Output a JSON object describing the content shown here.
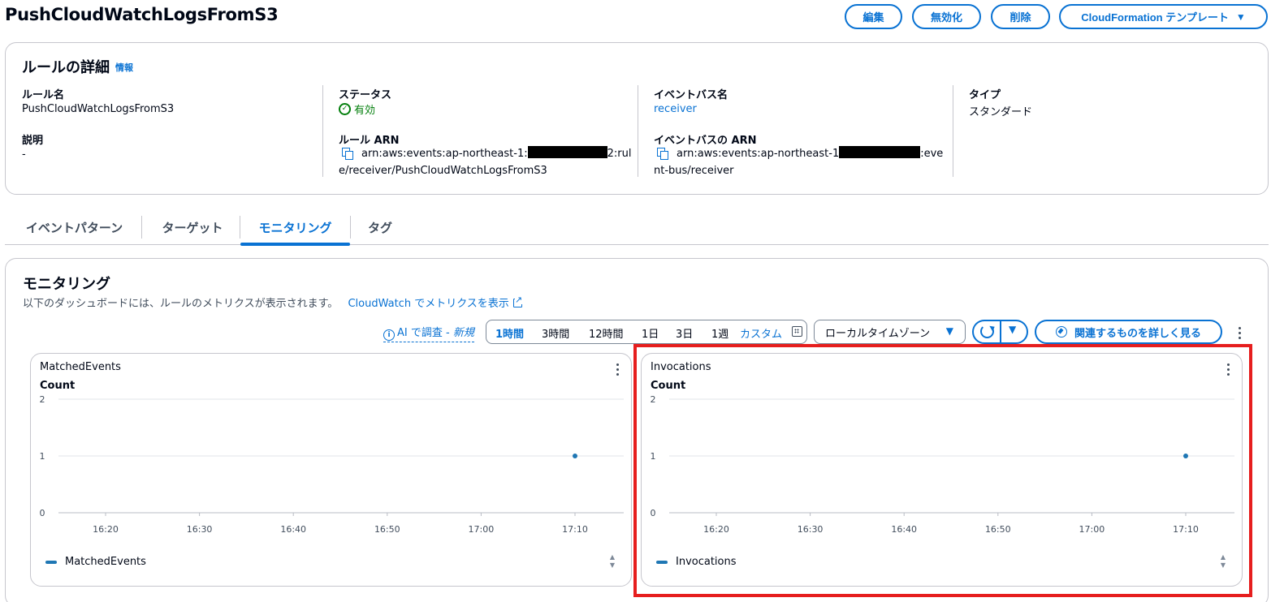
{
  "page": {
    "title": "PushCloudWatchLogsFromS3"
  },
  "header_actions": {
    "edit": "編集",
    "disable": "無効化",
    "delete": "削除",
    "cloudformation": "CloudFormation テンプレート"
  },
  "details": {
    "title": "ルールの詳細",
    "info": "情報",
    "rule_name_label": "ルール名",
    "rule_name": "PushCloudWatchLogsFromS3",
    "description_label": "説明",
    "description": "-",
    "status_label": "ステータス",
    "status": "有効",
    "rule_arn_label": "ルール ARN",
    "rule_arn_line1_prefix": "arn:aws:events:ap-northeast-1:",
    "rule_arn_line1_suffix": "2:rul",
    "rule_arn_line2": "e/receiver/PushCloudWatchLogsFromS3",
    "event_bus_label": "イベントバス名",
    "event_bus": "receiver",
    "event_bus_arn_label": "イベントバスの ARN",
    "event_bus_arn_line1_prefix": "arn:aws:events:ap-northeast-1",
    "event_bus_arn_line1_suffix": ":eve",
    "event_bus_arn_line2": "nt-bus/receiver",
    "type_label": "タイプ",
    "type": "スタンダード"
  },
  "tabs": [
    {
      "label": "イベントパターン"
    },
    {
      "label": "ターゲット"
    },
    {
      "label": "モニタリング"
    },
    {
      "label": "タグ"
    }
  ],
  "monitoring": {
    "title": "モニタリング",
    "description": "以下のダッシュボードには、ルールのメトリクスが表示されます。",
    "cloudwatch_link": "CloudWatch でメトリクスを表示",
    "ai_link": "AI で調査 - ",
    "ai_link_new": "新規",
    "ranges": [
      "1時間",
      "3時間",
      "12時間",
      "1日",
      "3日",
      "1週"
    ],
    "custom": "カスタム",
    "timezone": "ローカルタイムゾーン",
    "explore_button": "関連するものを詳しく見る"
  },
  "chart_data": [
    {
      "type": "line",
      "title": "MatchedEvents",
      "ylabel": "Count",
      "ylim": [
        0,
        2
      ],
      "yticks": [
        "0",
        "1",
        "2"
      ],
      "xticks": [
        "16:20",
        "16:30",
        "16:40",
        "16:50",
        "17:00",
        "17:10"
      ],
      "series": [
        {
          "name": "MatchedEvents",
          "points": [
            {
              "x": "17:10",
              "y": 1
            }
          ]
        }
      ],
      "grid": true,
      "legend": "bottom-left",
      "color": "#1f77b4"
    },
    {
      "type": "line",
      "title": "Invocations",
      "ylabel": "Count",
      "ylim": [
        0,
        2
      ],
      "yticks": [
        "0",
        "1",
        "2"
      ],
      "xticks": [
        "16:20",
        "16:30",
        "16:40",
        "16:50",
        "17:00",
        "17:10"
      ],
      "series": [
        {
          "name": "Invocations",
          "points": [
            {
              "x": "17:10",
              "y": 1
            }
          ]
        }
      ],
      "grid": true,
      "legend": "bottom-left",
      "color": "#1f77b4",
      "highlighted": true
    }
  ]
}
